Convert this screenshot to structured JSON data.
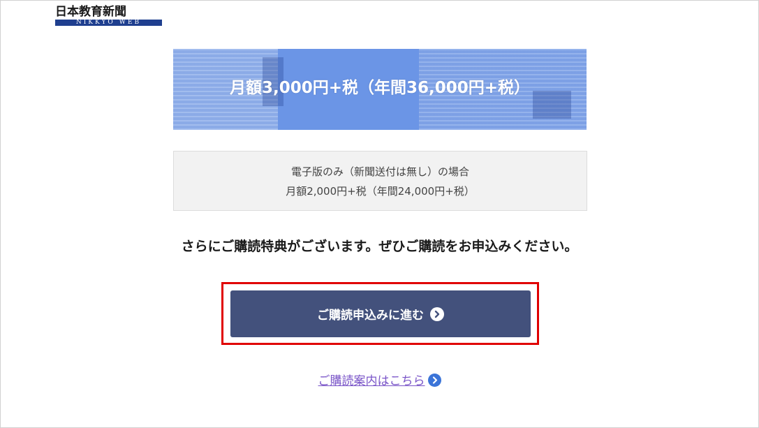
{
  "logo": {
    "japanese": "日本教育新聞",
    "english": "NIKKYO WEB"
  },
  "banner": {
    "price_text": "月額3,000円+税（年間36,000円+税）"
  },
  "digital_only": {
    "line1": "電子版のみ（新聞送付は無し）の場合",
    "line2": "月額2,000円+税（年間24,000円+税）"
  },
  "message": "さらにご購読特典がございます。ぜひご購読をお申込みください。",
  "cta": {
    "label": "ご購読申込みに進む",
    "icon": "chevron-right-circle-icon"
  },
  "guide": {
    "label": "ご購読案内はこちら",
    "icon": "chevron-right-circle-icon"
  },
  "colors": {
    "banner": "#6b95e6",
    "button": "#43517c",
    "highlight": "#e00000",
    "link": "#7a55c8",
    "logo_blue": "#1f3f8f"
  }
}
